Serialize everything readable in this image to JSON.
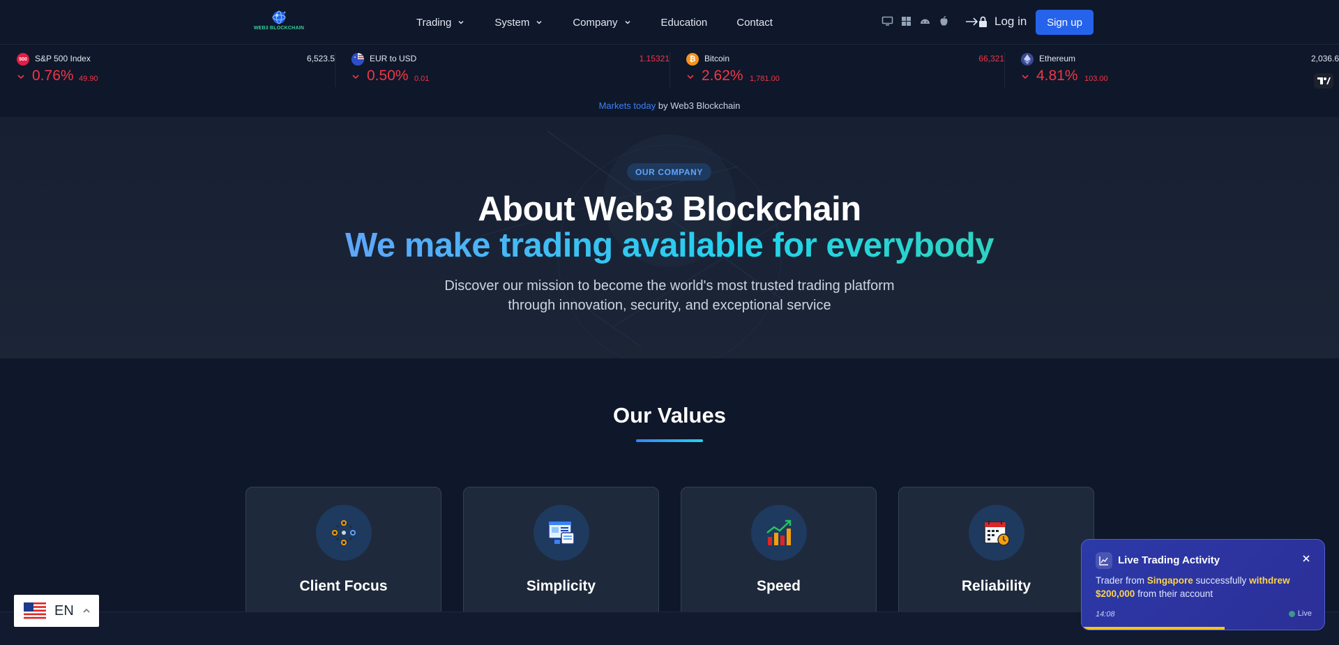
{
  "nav": {
    "logo_text": "WEB3 BLOCKCHAIN",
    "menu": [
      {
        "label": "Trading",
        "dropdown": true
      },
      {
        "label": "System",
        "dropdown": true
      },
      {
        "label": "Company",
        "dropdown": true
      },
      {
        "label": "Education",
        "dropdown": false
      },
      {
        "label": "Contact",
        "dropdown": false
      }
    ],
    "platforms": [
      "desktop-icon",
      "windows-icon",
      "android-icon",
      "apple-icon"
    ],
    "login_label": "Log in",
    "signup_label": "Sign up"
  },
  "ticker": {
    "items": [
      {
        "name": "S&P 500 Index",
        "icon": "500",
        "icon_color": "#e11d48",
        "price": "6,523.5",
        "price_color": "#e2e8f0",
        "change_pct": "0.76%",
        "change_abs": "49.90"
      },
      {
        "name": "EUR to USD",
        "icon": "eu-us-flag-icon",
        "icon_color": "#3b5bdb",
        "price": "1.15321",
        "price_color": "#f23645",
        "change_pct": "0.50%",
        "change_abs": "0.01"
      },
      {
        "name": "Bitcoin",
        "icon": "bitcoin-icon",
        "icon_color": "#f7931a",
        "price": "66,321",
        "price_color": "#f23645",
        "change_pct": "2.62%",
        "change_abs": "1,781.00"
      },
      {
        "name": "Ethereum",
        "icon": "ethereum-icon",
        "icon_color": "#3b4a8f",
        "price": "2,036.6",
        "price_color": "#e2e8f0",
        "change_pct": "4.81%",
        "change_abs": "103.00"
      }
    ],
    "down_color": "#f23645",
    "attribution_link": "Markets today",
    "attribution_text": "by Web3 Blockchain"
  },
  "hero": {
    "badge": "OUR COMPANY",
    "title": "About Web3 Blockchain",
    "subtitle": "We make trading available for everybody",
    "description": "Discover our mission to become the world's most trusted trading platform through innovation, security, and exceptional service"
  },
  "values": {
    "title": "Our Values",
    "cards": [
      {
        "title": "Client Focus",
        "icon": "network-people-icon"
      },
      {
        "title": "Simplicity",
        "icon": "browser-window-icon"
      },
      {
        "title": "Speed",
        "icon": "growth-chart-icon"
      },
      {
        "title": "Reliability",
        "icon": "calendar-clock-icon"
      }
    ]
  },
  "language": {
    "code": "EN",
    "flag": "us-flag-icon"
  },
  "toast": {
    "title": "Live Trading Activity",
    "msg_prefix": "Trader from ",
    "location": "Singapore",
    "msg_mid": " successfully ",
    "action": "withdrew",
    "amount": "$200,000",
    "msg_suffix": " from their account",
    "time": "14:08",
    "live_label": "Live",
    "progress": 0.59
  },
  "colors": {
    "background": "#0f172a",
    "accent": "#2563eb",
    "down": "#f23645",
    "highlight": "#fcd34d"
  }
}
